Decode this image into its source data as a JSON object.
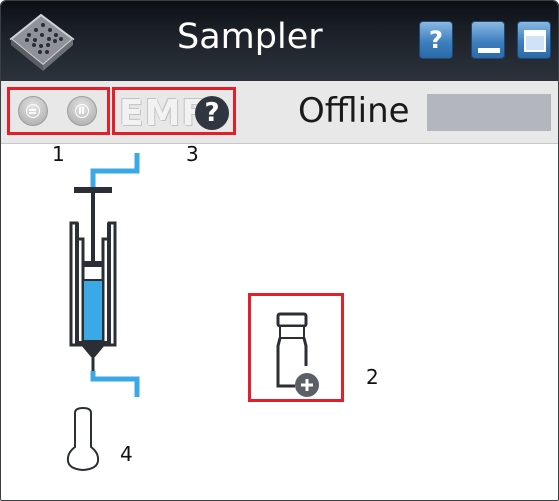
{
  "window": {
    "title": "Sampler",
    "buttons": {
      "help_label": "?"
    }
  },
  "toolbar": {
    "emf_label": "EMF",
    "emf_help_label": "?",
    "status_text": "Offline"
  },
  "callouts": {
    "one": "1",
    "two": "2",
    "three": "3",
    "four": "4"
  },
  "syringe": {
    "fill_level": 0.6
  },
  "colors": {
    "accent": "#3aa9e6",
    "highlight": "#e3202a",
    "titlebar": "#1e232b",
    "toolbar": "#e8e8e8",
    "status_indicator": "#b3b6bd"
  },
  "icons": {
    "logo": "sample-tray-icon",
    "sample_vial": "vial-add-icon",
    "temperature": "thermometer-icon",
    "syringe": "syringe-icon"
  }
}
